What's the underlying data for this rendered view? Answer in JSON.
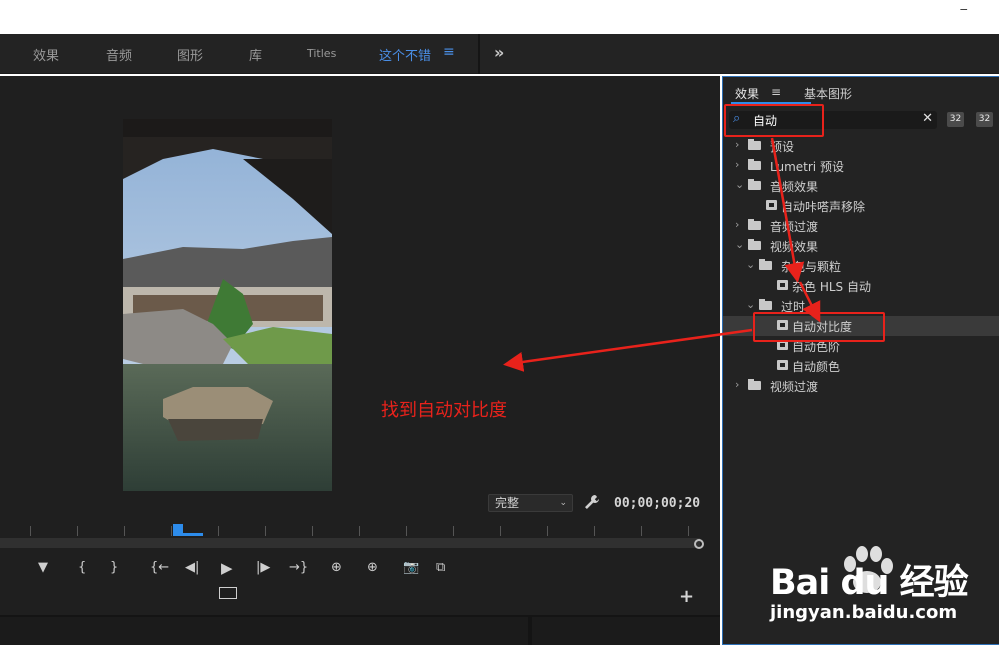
{
  "window": {
    "minimize_glyph": "_"
  },
  "workspace_tabs": [
    {
      "label": "效果"
    },
    {
      "label": "音频"
    },
    {
      "label": "图形"
    },
    {
      "label": "库"
    },
    {
      "label": "Titles"
    },
    {
      "label": "这个不错",
      "active": true
    }
  ],
  "workspace": {
    "menu_glyph": "≡",
    "more_glyph": "»"
  },
  "program_monitor": {
    "quality_label": "完整",
    "timecode": "00;00;00;20",
    "controls": [
      "▼",
      "{",
      "}",
      "{←",
      "◀|",
      "▶",
      "|▶",
      "→}",
      "⊕",
      "⊕",
      "📷",
      "⧉"
    ],
    "add_glyph": "+"
  },
  "effects_panel": {
    "tabs": [
      {
        "label": "效果",
        "active": true
      },
      {
        "label": "基本图形"
      }
    ],
    "tab_menu_glyph": "≡",
    "search": {
      "value": "自动"
    },
    "buttons": [
      "32",
      "32"
    ],
    "tree": [
      {
        "label": "预设",
        "type": "folder",
        "depth": 0,
        "expanded": false
      },
      {
        "label": "Lumetri 预设",
        "type": "folder",
        "depth": 0,
        "expanded": false
      },
      {
        "label": "音频效果",
        "type": "folder",
        "depth": 0,
        "expanded": true
      },
      {
        "label": "自动咔嗒声移除",
        "type": "effect",
        "depth": 1
      },
      {
        "label": "音频过渡",
        "type": "folder",
        "depth": 0,
        "expanded": false
      },
      {
        "label": "视频效果",
        "type": "folder",
        "depth": 0,
        "expanded": true
      },
      {
        "label": "杂色与颗粒",
        "type": "folder",
        "depth": 1,
        "expanded": true
      },
      {
        "label": "杂色 HLS 自动",
        "type": "effect",
        "depth": 2
      },
      {
        "label": "过时",
        "type": "folder",
        "depth": 1,
        "expanded": true
      },
      {
        "label": "自动对比度",
        "type": "effect",
        "depth": 2,
        "selected": true
      },
      {
        "label": "自动色阶",
        "type": "effect",
        "depth": 2
      },
      {
        "label": "自动颜色",
        "type": "effect",
        "depth": 2
      },
      {
        "label": "视频过渡",
        "type": "folder",
        "depth": 0,
        "expanded": false
      }
    ]
  },
  "annotation": {
    "text": "找到自动对比度",
    "color": "#e8221b"
  },
  "watermark": {
    "main": "Bai du 经验",
    "sub": "jingyan.baidu.com"
  },
  "colors": {
    "accent": "#2d8ceb",
    "panel_bg": "#232323",
    "annotation": "#e8221b"
  }
}
